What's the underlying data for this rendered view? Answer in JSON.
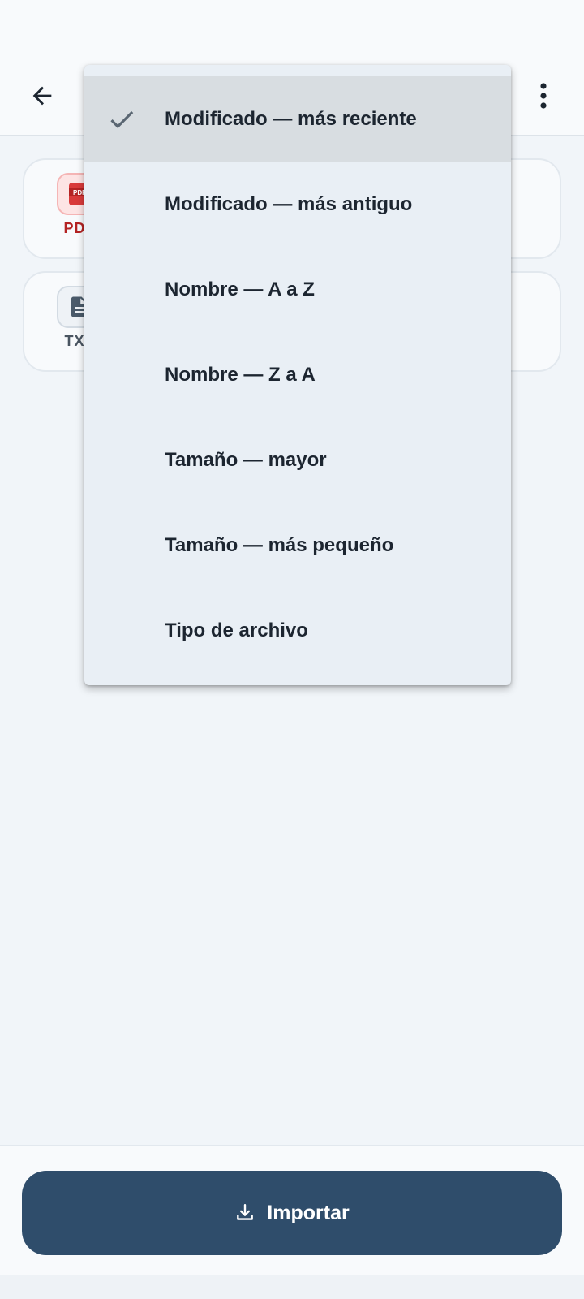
{
  "app_bar": {
    "back_icon": "arrow-left-icon",
    "more_icon": "more-vert-icon"
  },
  "files": [
    {
      "type_label": "PDF",
      "icon": "pdf-file-icon",
      "color": "#b42323"
    },
    {
      "type_label": "TXT",
      "icon": "text-file-icon",
      "color": "#4a5561"
    }
  ],
  "sort_menu": {
    "selected_index": 0,
    "check_icon": "check-icon",
    "items": [
      {
        "label": "Modificado — más reciente"
      },
      {
        "label": "Modificado — más antiguo"
      },
      {
        "label": "Nombre — A a Z"
      },
      {
        "label": "Nombre — Z a A"
      },
      {
        "label": "Tamaño — mayor"
      },
      {
        "label": "Tamaño — más pequeño"
      },
      {
        "label": "Tipo de archivo"
      }
    ]
  },
  "bottom": {
    "import_label": "Importar",
    "import_icon": "download-icon"
  },
  "colors": {
    "accent": "#2f4d6b",
    "menu_background": "#e9eff5",
    "selected_item": "#d8dde1",
    "pdf_red": "#b42323"
  }
}
